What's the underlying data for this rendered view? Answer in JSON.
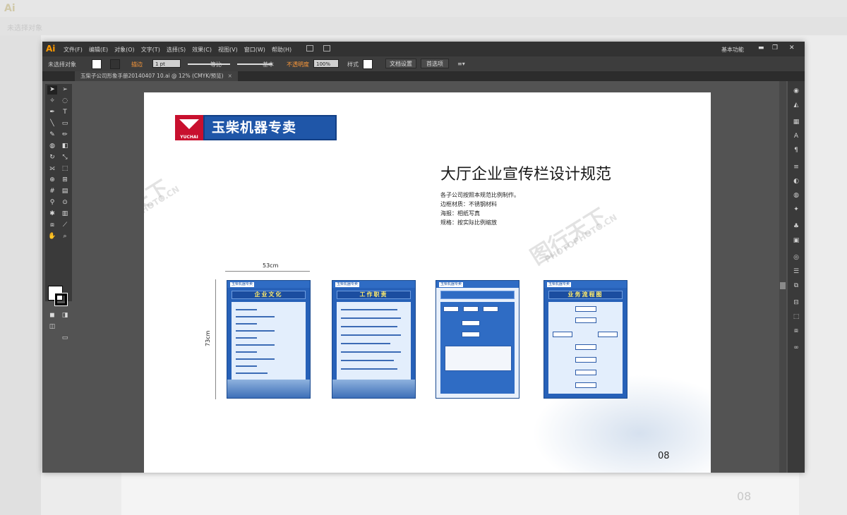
{
  "app": {
    "logo": "Ai",
    "workspace": "基本功能"
  },
  "menu": [
    "文件(F)",
    "编辑(E)",
    "对象(O)",
    "文字(T)",
    "选择(S)",
    "效果(C)",
    "视图(V)",
    "窗口(W)",
    "帮助(H)"
  ],
  "control_bar": {
    "selection": "未选择对象",
    "stroke_label": "描边",
    "stroke_weight": "1 pt",
    "profile_uniform": "等比",
    "brush_basic": "基本",
    "opacity_label": "不透明度",
    "opacity_value": "100%",
    "style_label": "样式",
    "doc_setup": "文档设置",
    "preferences": "首选项"
  },
  "document_tab": {
    "title": "玉柴子公司形象手册20140407 10.ai @ 12% (CMYK/预览)",
    "close": "×"
  },
  "artboard": {
    "logo_brand": "YUCHAI",
    "logo_text": "玉柴机器专卖",
    "heading": "大厅企业宣传栏设计规范",
    "spec_lines": [
      "各子公司按照本规范比例制作。",
      "边框材质：不锈钢材料",
      "海报：相纸写真",
      "规格：按实际比例缩放"
    ],
    "width_label": "53cm",
    "height_label": "73cm",
    "page_number": "08",
    "posters": [
      {
        "title": "企业文化"
      },
      {
        "title": "工作职责"
      },
      {
        "title": ""
      },
      {
        "title": "业务流程图"
      }
    ],
    "watermark_cn": "图行天下",
    "watermark_en": "PHOTOPHOTO.CN"
  },
  "background_app": {
    "selection": "未选择对象",
    "page_number": "08"
  }
}
